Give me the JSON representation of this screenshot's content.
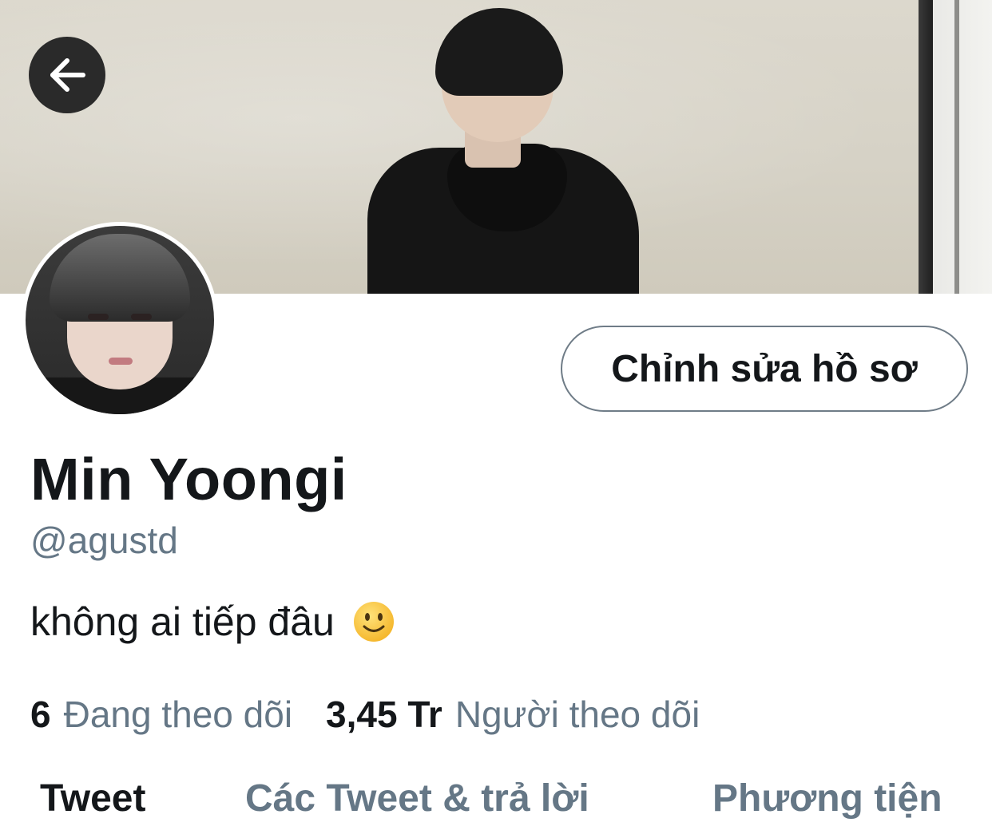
{
  "header": {
    "back_icon": "arrow-left-icon"
  },
  "profile": {
    "edit_button_label": "Chỉnh sửa hồ sơ",
    "display_name": "Min Yoongi",
    "handle": "@agustd",
    "bio": "không ai tiếp đâu",
    "bio_emoji": "slightly-smiling-face-icon"
  },
  "stats": {
    "following_count": "6",
    "following_label": "Đang theo dõi",
    "followers_count": "3,45 Tr",
    "followers_label": "Người theo dõi"
  },
  "tabs": [
    {
      "label": "Tweet",
      "active": true
    },
    {
      "label": "Các Tweet & trả lời",
      "active": false
    },
    {
      "label": "Phương tiện",
      "active": false
    }
  ],
  "colors": {
    "text_primary": "#14171a",
    "text_secondary": "#657786",
    "button_border": "#6f7c87",
    "back_button_bg": "#2a2a2a"
  }
}
